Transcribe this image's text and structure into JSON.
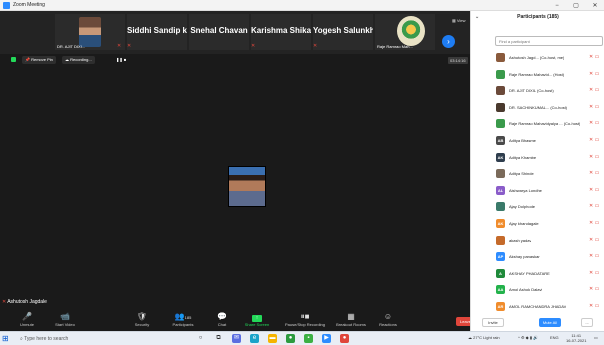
{
  "window": {
    "title": "Zoom Meeting",
    "controls": [
      "−",
      "▢",
      "✕"
    ]
  },
  "thumbnails": [
    {
      "name": "",
      "label": "DR. AJIT DIXI...",
      "kind": "photo"
    },
    {
      "name": "Siddhi Sandip k...",
      "label": "",
      "kind": "name"
    },
    {
      "name": "Snehal Chavan",
      "label": "",
      "kind": "name"
    },
    {
      "name": "Karishma Shikal...",
      "label": "",
      "kind": "name"
    },
    {
      "name": "Yogesh Salunkhe",
      "label": "",
      "kind": "name"
    },
    {
      "name": "",
      "label": "Raje Ramrao Mah...",
      "kind": "logo"
    }
  ],
  "view_label": "View",
  "infobar": {
    "remove_pin": "Remove Pin",
    "recording": "Recording...",
    "timer": "03:14:16"
  },
  "speaker": "Ashutosh Jagdale",
  "toolbar": {
    "items": [
      {
        "label": "Unmute",
        "icon": "🎤"
      },
      {
        "label": "Start Video",
        "icon": "📹"
      },
      {
        "label": "Security",
        "icon": "🛡"
      },
      {
        "label": "Participants",
        "icon": "👥",
        "count": "185"
      },
      {
        "label": "Chat",
        "icon": "💬"
      },
      {
        "label": "Share Screen",
        "icon": "↑"
      },
      {
        "label": "Pause/Stop Recording",
        "icon": "⏸■"
      },
      {
        "label": "Breakout Rooms",
        "icon": "▦"
      },
      {
        "label": "Reactions",
        "icon": "☺"
      }
    ],
    "leave": "Leave"
  },
  "participants": {
    "title": "Participants (185)",
    "search_placeholder": "Find a participant",
    "list": [
      {
        "name": "Ashutosh Jagd... (Co-host, me)",
        "initials": "",
        "color": "#8a5a3c"
      },
      {
        "name": "Raje Ramrao Mahavid... (Host)",
        "initials": "",
        "color": "#3a9a4b"
      },
      {
        "name": "DR. AJIT DIXIL (Co-host)",
        "initials": "",
        "color": "#6b4a3a"
      },
      {
        "name": "DR. SACHINKUMAL... (Co-host)",
        "initials": "",
        "color": "#4a3a2e"
      },
      {
        "name": "Raje Ramrao Mahavidyalya ... (Co-host)",
        "initials": "",
        "color": "#3a9a4b"
      },
      {
        "name": "Aditya Bhasme",
        "initials": "AB",
        "color": "#4a4a4a"
      },
      {
        "name": "Aditya Khambe",
        "initials": "AK",
        "color": "#2f3e4e"
      },
      {
        "name": "Aditya Shinde",
        "initials": "",
        "color": "#7a6a5a"
      },
      {
        "name": "Aishwarya Londhe",
        "initials": "AL",
        "color": "#8a5cc9"
      },
      {
        "name": "Ajay Dolphode",
        "initials": "",
        "color": "#3a7a6a"
      },
      {
        "name": "Ajay khandagale",
        "initials": "AK",
        "color": "#f08c2c"
      },
      {
        "name": "akash yadav",
        "initials": "",
        "color": "#c56a2a"
      },
      {
        "name": "Akshay panaskar",
        "initials": "AP",
        "color": "#2d8cff"
      },
      {
        "name": "AKSHAY PHADATARE",
        "initials": "A",
        "color": "#1f8a3a"
      },
      {
        "name": "Amol Ashok Dalavi",
        "initials": "AA",
        "color": "#23b24b"
      },
      {
        "name": "AMOL RAMCHANDRA JHADAV",
        "initials": "AR",
        "color": "#f08c2c"
      }
    ],
    "invite": "Invite",
    "mute_all": "Mute All",
    "more": "..."
  },
  "taskbar": {
    "search_placeholder": "Type here to search",
    "weather": "27°C Light rain",
    "language": "ENG",
    "time": "11:41",
    "date": "16-07-2021"
  }
}
